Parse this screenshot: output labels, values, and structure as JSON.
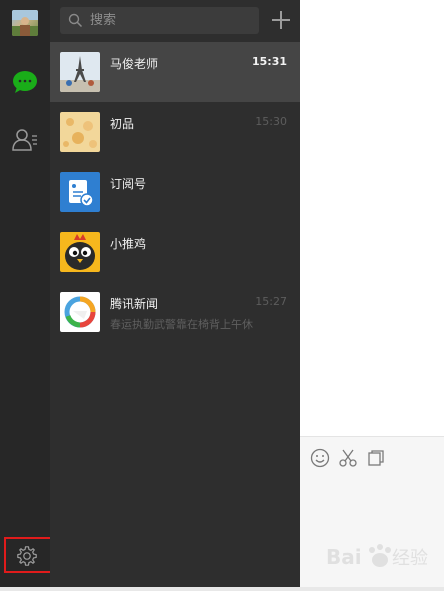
{
  "sidebar": {
    "icons": [
      "avatar",
      "chat-bubble-icon",
      "contacts-icon",
      "gear-icon"
    ]
  },
  "search": {
    "placeholder": "搜索"
  },
  "chats": [
    {
      "name": "马俊老师",
      "time": "15:31",
      "preview": "",
      "active": true
    },
    {
      "name": "初品",
      "time": "15:30",
      "preview": "",
      "active": false
    },
    {
      "name": "订阅号",
      "time": "",
      "preview": "",
      "active": false
    },
    {
      "name": "小推鸡",
      "time": "",
      "preview": "",
      "active": false
    },
    {
      "name": "腾讯新闻",
      "time": "15:27",
      "preview": "春运执勤武警靠在椅背上午休",
      "active": false
    }
  ],
  "colors": {
    "sidebar_bg": "#272727",
    "list_bg": "#2e2e2e",
    "active_row": "#454545",
    "accent_green": "#1aad19",
    "highlight_border": "#e01b1b"
  },
  "watermark": {
    "text": "Bai 经验"
  }
}
